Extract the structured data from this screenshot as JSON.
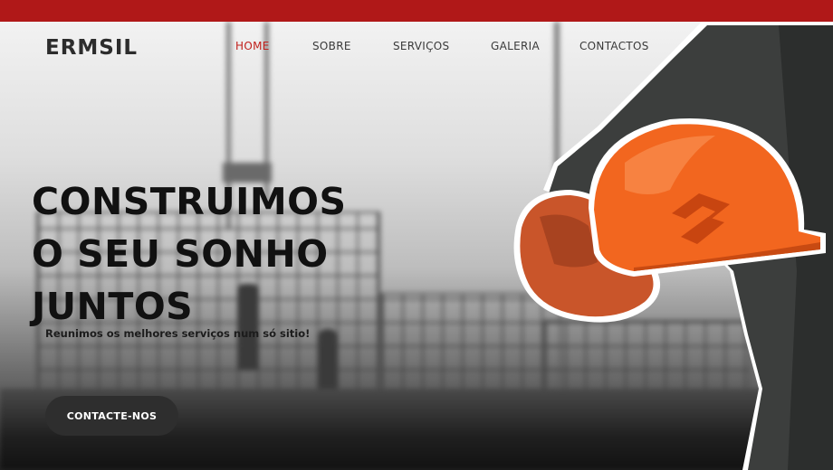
{
  "brand": {
    "logo": "ERMSIL"
  },
  "nav": {
    "items": [
      {
        "label": "HOME",
        "active": true
      },
      {
        "label": "SOBRE",
        "active": false
      },
      {
        "label": "SERVIÇOS",
        "active": false
      },
      {
        "label": "GALERIA",
        "active": false
      },
      {
        "label": "CONTACTOS",
        "active": false
      }
    ]
  },
  "hero": {
    "headline": [
      "CONSTRUIMOS",
      "O SEU SONHO",
      "JUNTOS"
    ],
    "subtitle": "Reunimos os melhores serviços num só sitio!",
    "cta_label": "CONTACTE-NOS"
  },
  "colors": {
    "topbar": "#b01818",
    "nav_active": "#c0201c",
    "helmet": "#f2661f",
    "cta_background": "#2e2e2e"
  }
}
